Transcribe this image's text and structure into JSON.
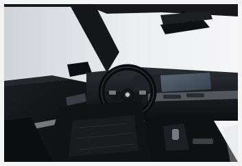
{
  "image": {
    "subject": "car-interior-photo",
    "colors": {
      "frame": "#f4f4f4",
      "window_light": "#e7e9ec",
      "headliner": "#1a1c20",
      "leather": "#121316",
      "wood_trim": "#6c6f74",
      "ambient_accent": "#c9cdd3",
      "screen": "#4d5865"
    }
  }
}
